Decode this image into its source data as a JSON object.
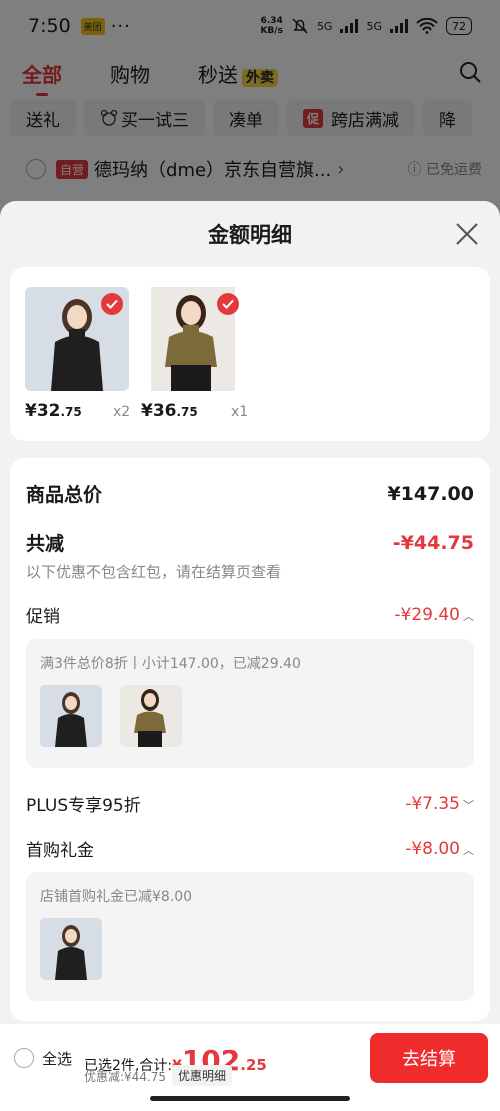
{
  "status": {
    "time": "7:50",
    "app_badge": "美团",
    "dots": "···",
    "speed_top": "6.34",
    "speed_bottom": "KB/s",
    "net1": "5G",
    "net2": "5G",
    "battery": "72"
  },
  "tabs": [
    {
      "label": "全部",
      "active": true
    },
    {
      "label": "购物"
    },
    {
      "label": "秒送",
      "badge": "外卖"
    }
  ],
  "chips": [
    {
      "label": "送礼"
    },
    {
      "label": "买一试三"
    },
    {
      "label": "凑单"
    },
    {
      "label": "跨店满减",
      "tag": "促"
    },
    {
      "label": "降"
    }
  ],
  "store": {
    "tag": "自营",
    "name": "德玛纳（dme）京东自营旗...",
    "chevron": "›",
    "shipping": "ⓘ 已免运费"
  },
  "sheet": {
    "title": "金额明细",
    "items": [
      {
        "price_int": "¥32",
        "price_dec": ".75",
        "qty": "x2"
      },
      {
        "price_int": "¥36",
        "price_dec": ".75",
        "qty": "x1"
      }
    ],
    "total_label": "商品总价",
    "total_value": "¥147.00",
    "reduce_label": "共减",
    "reduce_value": "-¥44.75",
    "reduce_note": "以下优惠不包含红包，请在结算页查看",
    "promo_label": "促销",
    "promo_value": "-¥29.40",
    "promo_detail": "满3件总价8折丨小计147.00，已减29.40",
    "plus_label": "PLUS专享95折",
    "plus_value": "-¥7.35",
    "first_label": "首购礼金",
    "first_value": "-¥8.00",
    "first_detail": "店铺首购礼金已减¥8.00"
  },
  "bottom": {
    "select_all": "全选",
    "selected_text": "已选2件,合计:",
    "currency": "¥",
    "total_int": "102",
    "total_dec": ".25",
    "discount_text": "优惠减:¥44.75",
    "detail_label": "优惠明细",
    "checkout_label": "去结算"
  },
  "colors": {
    "accent": "#e4393c",
    "overlay": "rgba(0,0,0,0.5)"
  }
}
